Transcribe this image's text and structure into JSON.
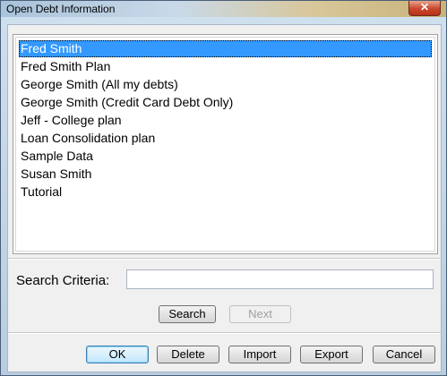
{
  "window": {
    "title": "Open Debt Information",
    "close_glyph": "✕"
  },
  "list": {
    "items": [
      {
        "label": "Fred Smith",
        "selected": true
      },
      {
        "label": "Fred Smith Plan"
      },
      {
        "label": "George Smith (All my debts)"
      },
      {
        "label": "George Smith (Credit Card Debt Only)"
      },
      {
        "label": "Jeff - College plan"
      },
      {
        "label": "Loan Consolidation plan"
      },
      {
        "label": "Sample Data"
      },
      {
        "label": "Susan Smith"
      },
      {
        "label": "Tutorial"
      }
    ]
  },
  "search": {
    "label": "Search Criteria:",
    "value": "",
    "search_button": "Search",
    "next_button": "Next"
  },
  "buttons": {
    "ok": "OK",
    "delete": "Delete",
    "import": "Import",
    "export": "Export",
    "cancel": "Cancel"
  },
  "colors": {
    "selection": "#3399ff",
    "close_button": "#c9462c",
    "dialog_bg": "#f0f0f0"
  }
}
